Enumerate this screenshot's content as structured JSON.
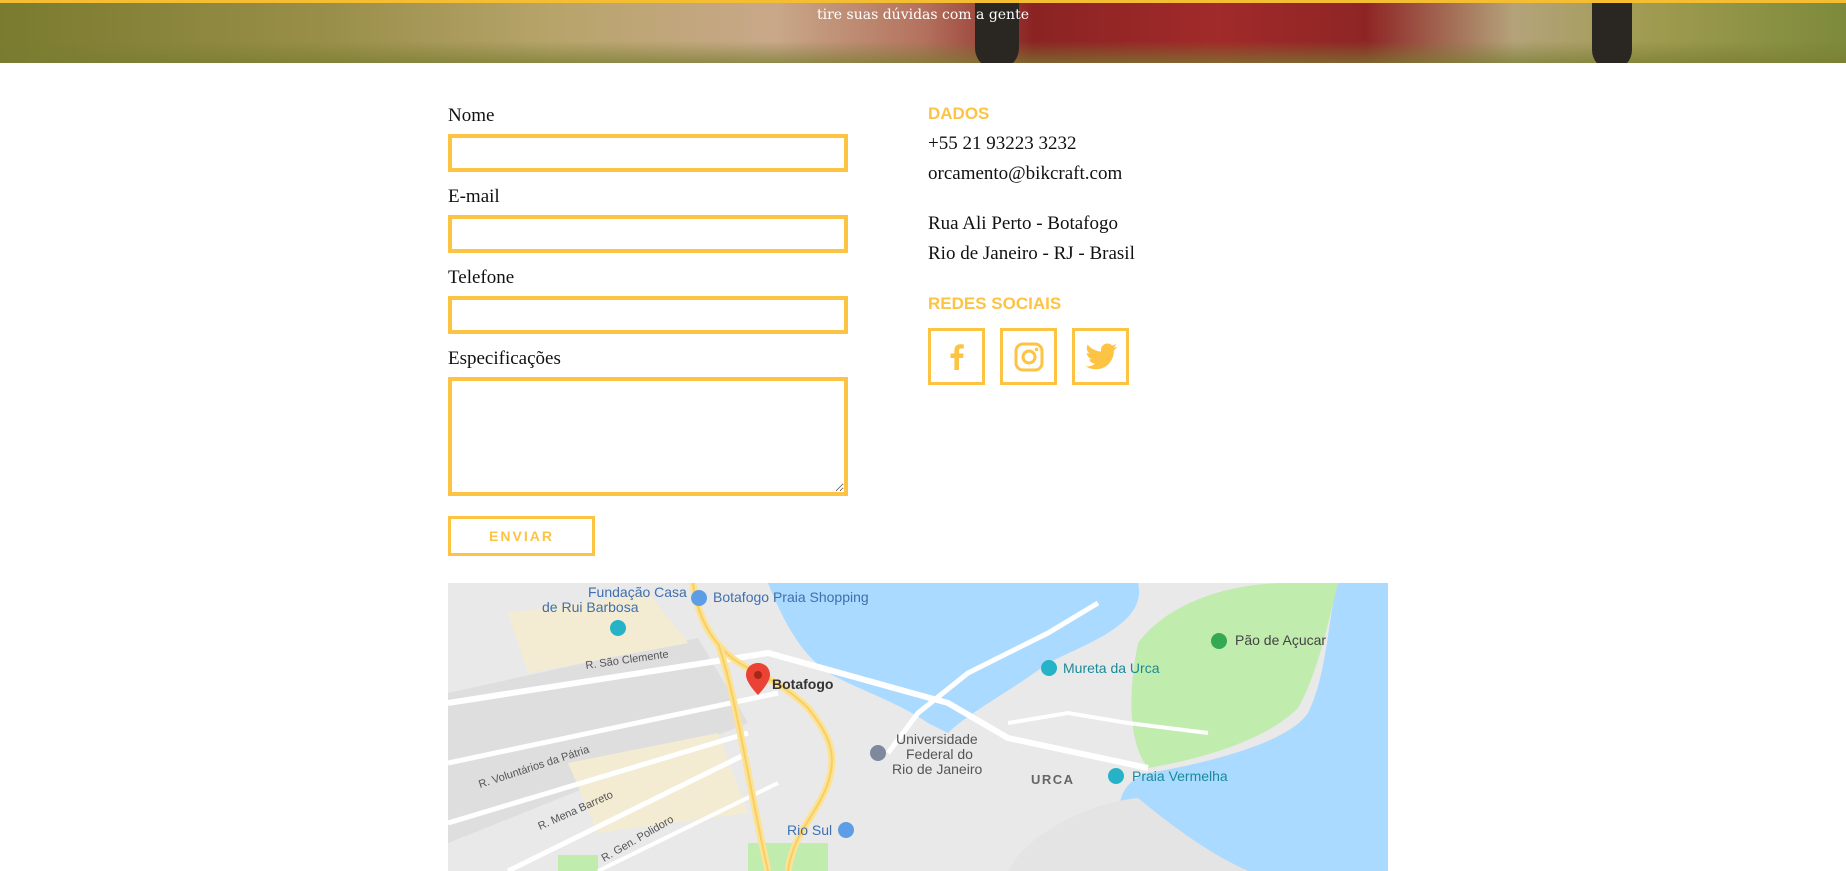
{
  "hero": {
    "subtitle": "tire suas dúvidas com a gente"
  },
  "form": {
    "name_label": "Nome",
    "email_label": "E-mail",
    "phone_label": "Telefone",
    "specs_label": "Especificações",
    "submit_label": "ENVIAR"
  },
  "contact": {
    "heading": "DADOS",
    "phone": "+55 21 93223 3232",
    "email": "orcamento@bikcraft.com",
    "address_line1": "Rua Ali Perto - Botafogo",
    "address_line2": "Rio de Janeiro - RJ - Brasil"
  },
  "social": {
    "heading": "REDES SOCIAIS",
    "items": [
      {
        "icon": "facebook-icon"
      },
      {
        "icon": "instagram-icon"
      },
      {
        "icon": "twitter-icon"
      }
    ]
  },
  "map": {
    "labels": {
      "fundacao_1": "Fundação Casa",
      "fundacao_2": "de Rui Barbosa",
      "shopping": "Botafogo Praia Shopping",
      "pao": "Pão de Açucar",
      "sao_clemente": "R. São Clemente",
      "botafogo": "Botafogo",
      "mureta": "Mureta da Urca",
      "univ_1": "Universidade",
      "univ_2": "Federal do",
      "univ_3": "Rio de Janeiro",
      "voluntarios": "R. Voluntários da Pátria",
      "urca": "URCA",
      "praia_vermelha": "Praia Vermelha",
      "mena_barreto": "R. Mena Barreto",
      "gen_polidoro": "R. Gen. Polidoro",
      "rio_sul": "Rio Sul"
    }
  },
  "colors": {
    "accent": "#fdc342",
    "text": "#111111",
    "water": "#aadaff",
    "park": "#c0ecae"
  }
}
